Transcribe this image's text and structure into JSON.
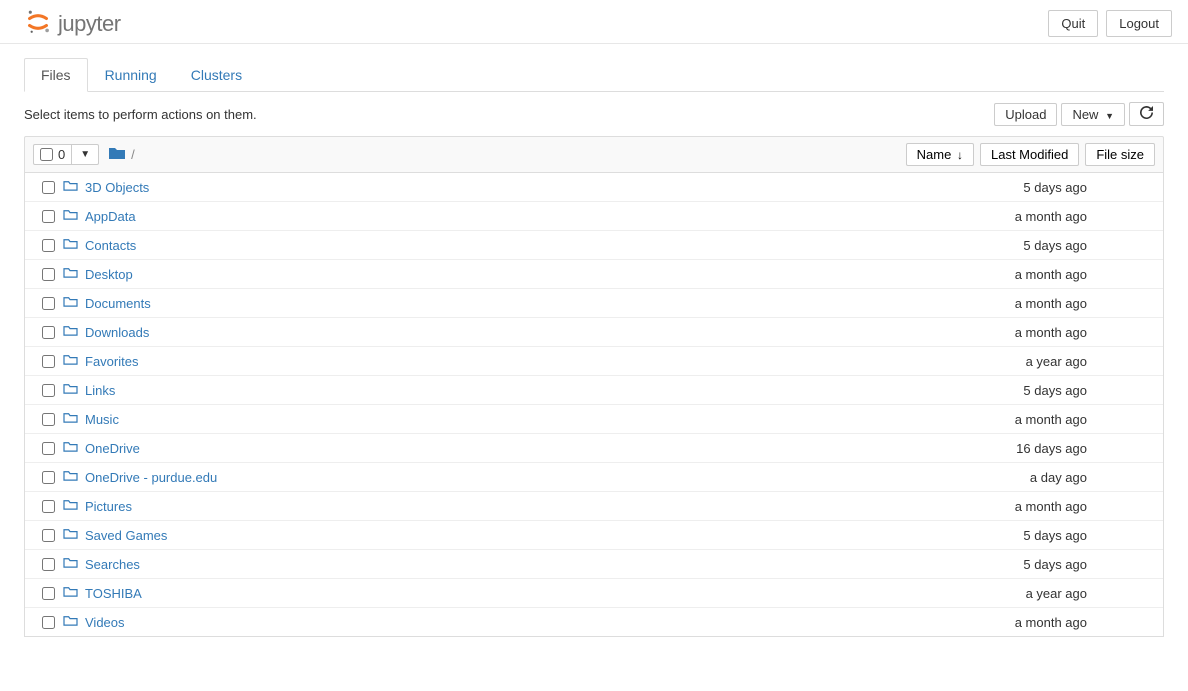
{
  "header": {
    "logo_text": "jupyter",
    "quit_label": "Quit",
    "logout_label": "Logout"
  },
  "tabs": {
    "files": "Files",
    "running": "Running",
    "clusters": "Clusters"
  },
  "toolbar": {
    "hint": "Select items to perform actions on them.",
    "upload_label": "Upload",
    "new_label": "New",
    "select_count": "0",
    "breadcrumb_sep": "/"
  },
  "columns": {
    "name_label": "Name",
    "modified_label": "Last Modified",
    "size_label": "File size"
  },
  "items": [
    {
      "name": "3D Objects",
      "modified": "5 days ago",
      "size": ""
    },
    {
      "name": "AppData",
      "modified": "a month ago",
      "size": ""
    },
    {
      "name": "Contacts",
      "modified": "5 days ago",
      "size": ""
    },
    {
      "name": "Desktop",
      "modified": "a month ago",
      "size": ""
    },
    {
      "name": "Documents",
      "modified": "a month ago",
      "size": ""
    },
    {
      "name": "Downloads",
      "modified": "a month ago",
      "size": ""
    },
    {
      "name": "Favorites",
      "modified": "a year ago",
      "size": ""
    },
    {
      "name": "Links",
      "modified": "5 days ago",
      "size": ""
    },
    {
      "name": "Music",
      "modified": "a month ago",
      "size": ""
    },
    {
      "name": "OneDrive",
      "modified": "16 days ago",
      "size": ""
    },
    {
      "name": "OneDrive - purdue.edu",
      "modified": "a day ago",
      "size": ""
    },
    {
      "name": "Pictures",
      "modified": "a month ago",
      "size": ""
    },
    {
      "name": "Saved Games",
      "modified": "5 days ago",
      "size": ""
    },
    {
      "name": "Searches",
      "modified": "5 days ago",
      "size": ""
    },
    {
      "name": "TOSHIBA",
      "modified": "a year ago",
      "size": ""
    },
    {
      "name": "Videos",
      "modified": "a month ago",
      "size": ""
    }
  ]
}
